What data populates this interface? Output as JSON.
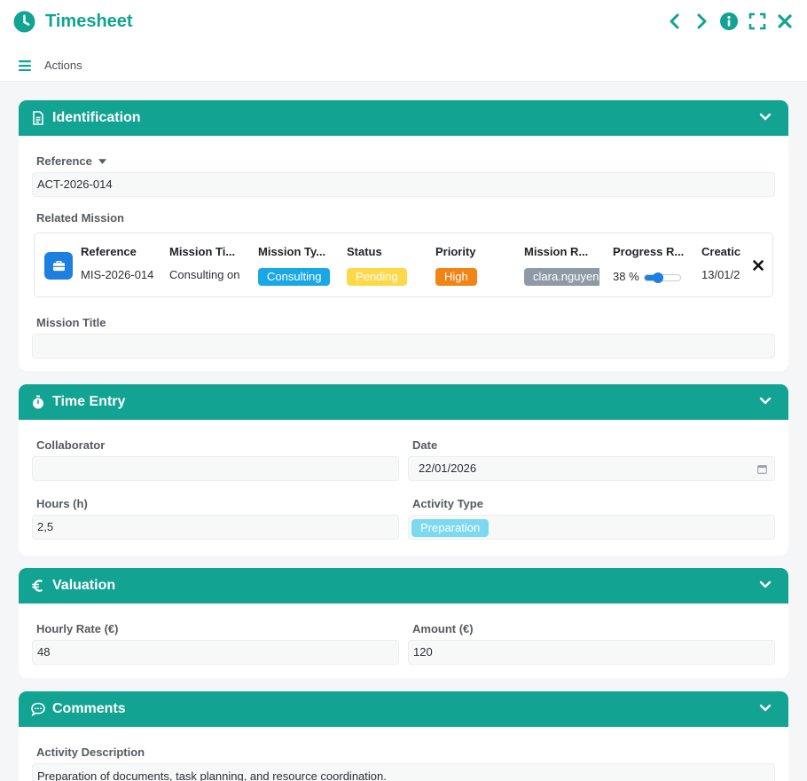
{
  "app": {
    "title": "Timesheet",
    "actions_label": "Actions"
  },
  "sections": {
    "identification": {
      "title": "Identification",
      "reference_label": "Reference",
      "reference_value": "ACT-2026-014",
      "related_mission_label": "Related Mission",
      "mission_title_label": "Mission Title",
      "mission_title_value": ""
    },
    "time_entry": {
      "title": "Time Entry",
      "collaborator_label": "Collaborator",
      "collaborator_value": "",
      "date_label": "Date",
      "date_value": "22/01/2026",
      "hours_label": "Hours (h)",
      "hours_value": "2,5",
      "activity_type_label": "Activity Type",
      "activity_type_value": "Preparation"
    },
    "valuation": {
      "title": "Valuation",
      "hourly_rate_label": "Hourly Rate (€)",
      "hourly_rate_value": "48",
      "amount_label": "Amount (€)",
      "amount_value": "120"
    },
    "comments": {
      "title": "Comments",
      "description_label": "Activity Description",
      "description_value": "Preparation of documents, task planning, and resource coordination."
    }
  },
  "mission": {
    "headers": [
      "Reference",
      "Mission Ti...",
      "Mission Ty...",
      "Status",
      "Priority",
      "Mission R...",
      "Progress R...",
      "Creatic"
    ],
    "reference": "MIS-2026-014",
    "mission_title": "Consulting on",
    "mission_type": "Consulting",
    "status": "Pending",
    "priority": "High",
    "responsible": "clara.nguyen",
    "progress_text": "38 %",
    "progress": 0.38,
    "created": "13/01/2"
  },
  "colors": {
    "accent": "#12a392",
    "consulting": "#1aa7e8",
    "pending": "#ffd84a",
    "high": "#f28416",
    "user_badge": "#8e9aa6",
    "preparation": "#7dd9ef",
    "slider": "#1d7fe0"
  },
  "icons": [
    "clock-icon",
    "chevron-left-icon",
    "chevron-right-icon",
    "info-icon",
    "fullscreen-icon",
    "close-icon",
    "hamburger-icon",
    "document-icon",
    "stopwatch-icon",
    "euro-icon",
    "chat-icon",
    "briefcase-icon",
    "calendar-icon",
    "remove-icon",
    "chevron-down-icon",
    "caret-down-icon"
  ]
}
